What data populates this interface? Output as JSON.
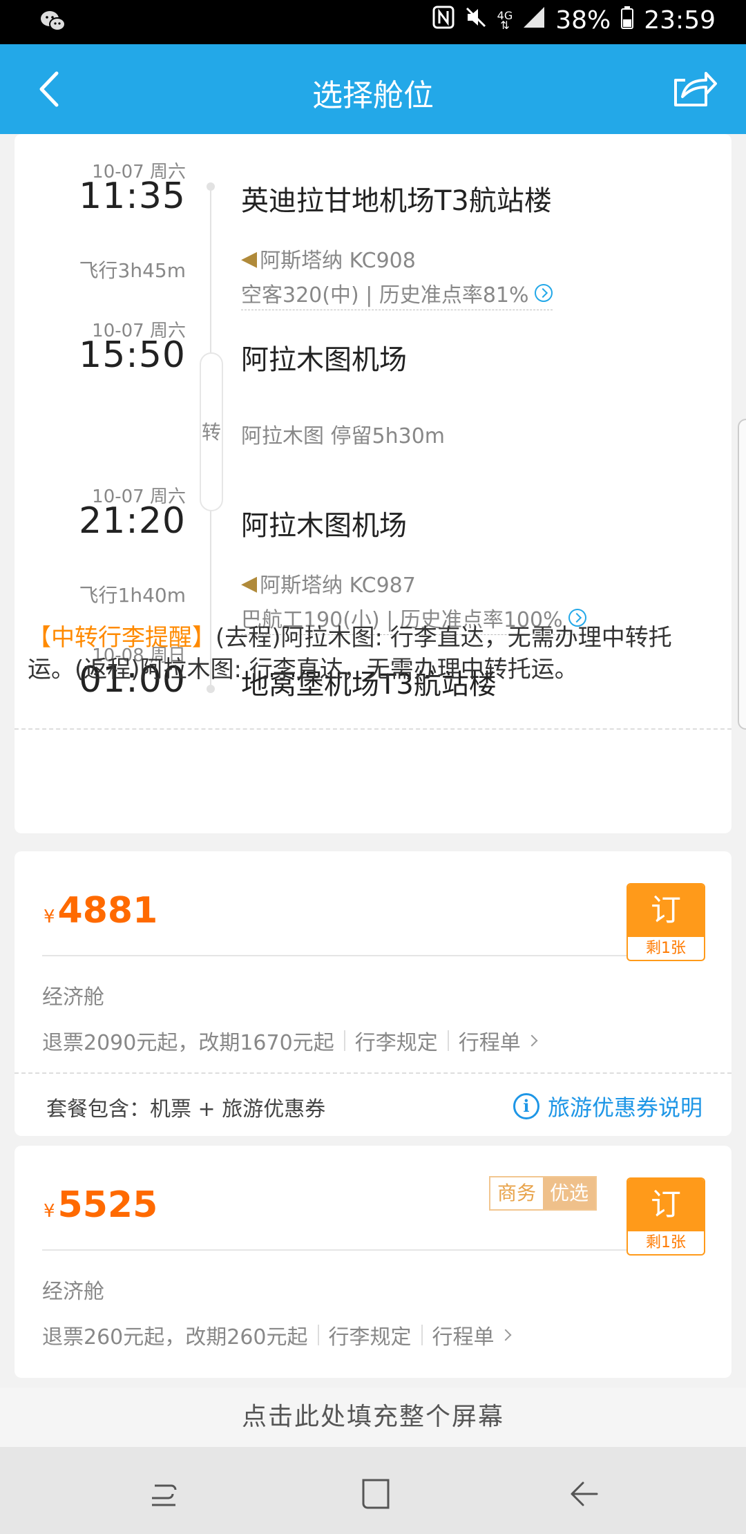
{
  "status_bar": {
    "icons": [
      "wechat-icon",
      "nfc-icon",
      "mute-icon",
      "network-4g-icon",
      "signal-icon",
      "battery-icon"
    ],
    "network": "4G",
    "battery": "38%",
    "time": "23:59"
  },
  "header": {
    "title": "选择舱位",
    "back_icon": "chevron-left-icon",
    "share_icon": "share-icon"
  },
  "itinerary": {
    "segments": [
      {
        "date": "10-07 周六",
        "time": "11:35",
        "airport": "英迪拉甘地机场T3航站楼"
      },
      {
        "duration": "飞行3h45m",
        "airline": "阿斯塔纳 KC908",
        "plane": "空客320(中) | 历史准点率81%"
      },
      {
        "date": "10-07 周六",
        "time": "15:50",
        "airport": "阿拉木图机场"
      },
      {
        "transfer_char": "转",
        "transfer_info": "阿拉木图  停留5h30m"
      },
      {
        "date": "10-07 周六",
        "time": "21:20",
        "airport": "阿拉木图机场"
      },
      {
        "duration": "飞行1h40m",
        "airline": "阿斯塔纳 KC987",
        "plane": "巴航工190(小) | 历史准点率100%"
      },
      {
        "date": "10-08 周日",
        "time": "01:00",
        "airport": "地窝堡机场T3航站楼"
      }
    ],
    "notice_highlight": "【中转行李提醒】",
    "notice_text": "(去程)阿拉木图: 行李直达，无需办理中转托运。(返程)阿拉木图: 行李直达，无需办理中转托运。"
  },
  "fares": [
    {
      "currency": "¥",
      "price": "4881",
      "cabin": "经济舱",
      "refund": "退票2090元起，改期1670元起",
      "baggage": "行李规定",
      "itinerary_link": "行程单",
      "book": "订",
      "remaining": "剩1张",
      "package": "套餐包含：机票 + 旅游优惠券",
      "coupon": "旅游优惠券说明"
    },
    {
      "currency": "¥",
      "price": "5525",
      "tag_a": "商务",
      "tag_b": "优选",
      "cabin": "经济舱",
      "refund": "退票260元起，改期260元起",
      "baggage": "行李规定",
      "itinerary_link": "行程单",
      "book": "订",
      "remaining": "剩1张"
    }
  ],
  "fill_screen": "点击此处填充整个屏幕",
  "nav": [
    "recent-apps-icon",
    "home-icon",
    "back-icon"
  ],
  "colors": {
    "primary": "#23a8e8",
    "accent": "#ff6a00",
    "book": "#ff9a1a",
    "link": "#1e96e6"
  }
}
